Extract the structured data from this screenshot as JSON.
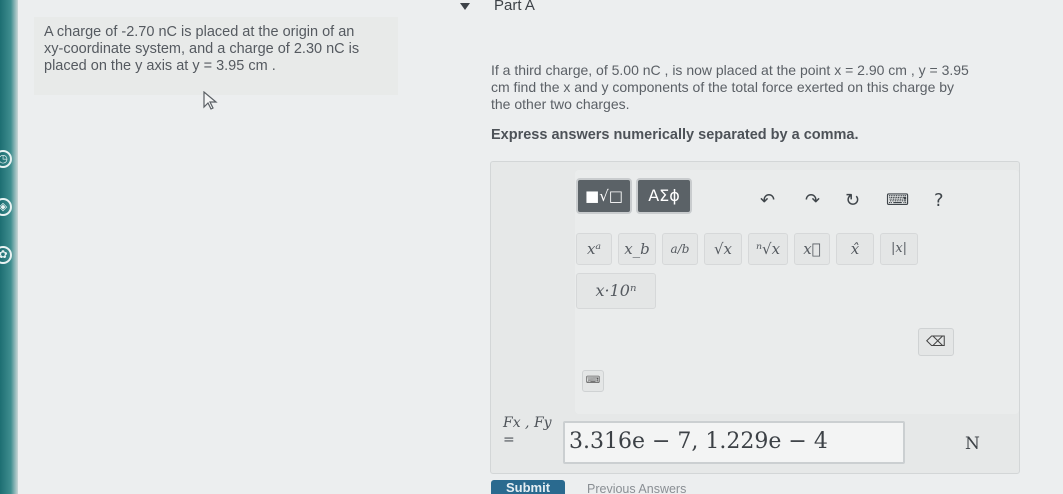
{
  "problem": {
    "lines": [
      "A charge of -2.70 nC is placed at the origin of an",
      "xy-coordinate system, and a charge of 2.30 nC is",
      "placed on the y axis at y = 3.95 cm ."
    ]
  },
  "part": {
    "label": "Part A"
  },
  "question": {
    "lines": [
      "If a third charge, of 5.00 nC , is now placed at the point x = 2.90 cm , y = 3.95",
      "cm find the x and y components of the total force exerted on this charge by",
      "the other two charges."
    ],
    "instruction": "Express answers numerically separated by a comma."
  },
  "toolbar": {
    "templates_label": "■√□",
    "greek_label": "ΑΣϕ",
    "undo_icon": "↶",
    "redo_icon": "↷",
    "reset_icon": "↻",
    "keyboard_icon": "⌨",
    "help_label": "?",
    "symbols": [
      "xᵃ",
      "x_b",
      "a/b",
      "√x",
      "ⁿ√x",
      "x⃗",
      "x̂",
      "|x|"
    ],
    "sci_label": "x·10ⁿ",
    "backspace_icon": "⌫"
  },
  "answer": {
    "label_line1": "Fx , Fy",
    "label_line2": "=",
    "value": "3.316e − 7, 1.229e − 4",
    "unit": "N"
  },
  "buttons": {
    "submit": "Submit",
    "previous": "Previous Answers"
  }
}
